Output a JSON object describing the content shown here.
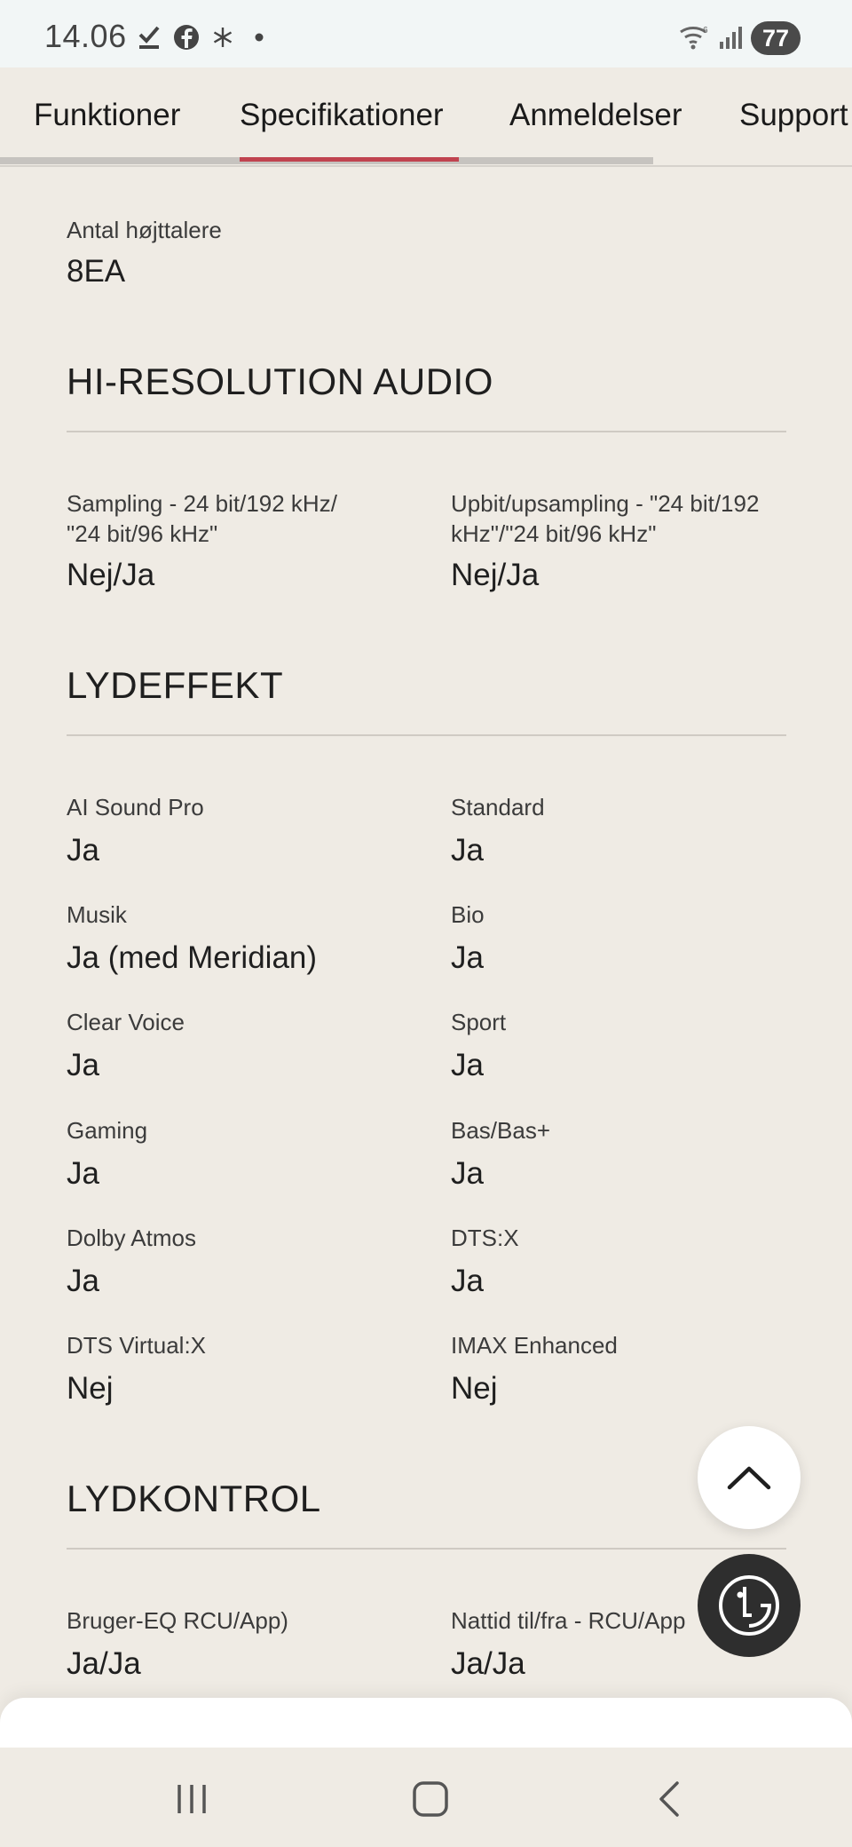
{
  "status_bar": {
    "time": "14.06",
    "battery": "77",
    "icons": [
      "download-done-icon",
      "facebook-icon",
      "snowflake-icon",
      "dot-icon",
      "wifi-icon",
      "signal-icon"
    ]
  },
  "tabs": [
    {
      "label": "Funktioner"
    },
    {
      "label": "Specifikationer",
      "active": true
    },
    {
      "label": "Anmeldelser"
    },
    {
      "label": "Support"
    }
  ],
  "top_spec": {
    "label": "Antal højttalere",
    "value": "8EA"
  },
  "sections": [
    {
      "heading": "HI-RESOLUTION AUDIO",
      "items": [
        {
          "label": "Sampling - 24 bit/192 kHz/\n\"24 bit/96 kHz\"",
          "value": "Nej/Ja"
        },
        {
          "label": "Upbit/upsampling - \"24 bit/192\nkHz\"/\"24 bit/96 kHz\"",
          "value": "Nej/Ja"
        }
      ]
    },
    {
      "heading": "LYDEFFEKT",
      "items": [
        {
          "label": "AI Sound Pro",
          "value": "Ja"
        },
        {
          "label": "Standard",
          "value": "Ja"
        },
        {
          "label": "Musik",
          "value": "Ja (med Meridian)"
        },
        {
          "label": "Bio",
          "value": "Ja"
        },
        {
          "label": "Clear Voice",
          "value": "Ja"
        },
        {
          "label": "Sport",
          "value": "Ja"
        },
        {
          "label": "Gaming",
          "value": "Ja"
        },
        {
          "label": "Bas/Bas+",
          "value": "Ja"
        },
        {
          "label": "Dolby Atmos",
          "value": "Ja"
        },
        {
          "label": "DTS:X",
          "value": "Ja"
        },
        {
          "label": "DTS Virtual:X",
          "value": "Nej"
        },
        {
          "label": "IMAX Enhanced",
          "value": "Nej"
        }
      ]
    },
    {
      "heading": "LYDKONTROL",
      "items": [
        {
          "label": "Bruger-EQ RCU/App)",
          "value": "Ja/Ja"
        },
        {
          "label": "Nattid til/fra - RCU/App",
          "value": "Ja/Ja"
        }
      ]
    }
  ],
  "colors": {
    "accent": "#c0434f",
    "background": "#efebe4"
  }
}
